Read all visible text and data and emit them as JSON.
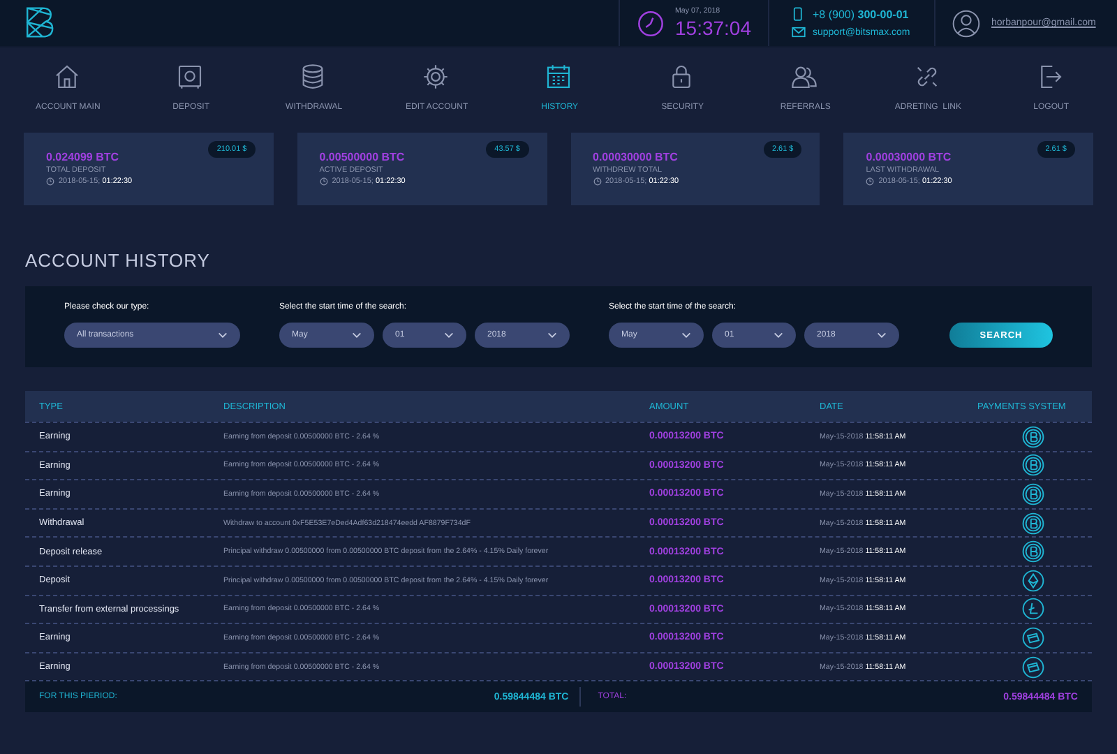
{
  "header": {
    "date": "May 07, 2018",
    "time": "15:37:04",
    "phone_prefix": "+8 (900) ",
    "phone_number": "300-00-01",
    "email": "support@bitsmax.com",
    "user_email": "horbanpour@gmail.com"
  },
  "nav": [
    {
      "label": "ACCOUNT MAIN",
      "kind": "home",
      "selected": false
    },
    {
      "label": "DEPOSIT",
      "kind": "safe",
      "selected": false
    },
    {
      "label": "WITHDRAWAL",
      "kind": "coins",
      "selected": false
    },
    {
      "label": "EDIT ACCOUNT",
      "kind": "gear",
      "selected": false
    },
    {
      "label": "HISTORY",
      "kind": "calendar",
      "selected": true
    },
    {
      "label": "SECURITY",
      "kind": "lock",
      "selected": false
    },
    {
      "label": "REFERRALS",
      "kind": "users",
      "selected": false
    },
    {
      "label": "ADRETING  LINK",
      "kind": "link",
      "selected": false
    },
    {
      "label": "LOGOUT",
      "kind": "logout",
      "selected": false
    }
  ],
  "cards": [
    {
      "amount": "0.024099 BTC",
      "usd": "210.01 $",
      "label": "TOTAL DEPOSIT",
      "date": "2018-05-15;",
      "time": "01:22:30"
    },
    {
      "amount": "0.00500000 BTC",
      "usd": "43.57 $",
      "label": "ACTIVE DEPOSIT",
      "date": "2018-05-15;",
      "time": "01:22:30"
    },
    {
      "amount": "0.00030000 BTC",
      "usd": "2.61 $",
      "label": "WITHDREW TOTAL",
      "date": "2018-05-15;",
      "time": "01:22:30"
    },
    {
      "amount": "0.00030000 BTC",
      "usd": "2.61 $",
      "label": "LAST WITHDRAWAL",
      "date": "2018-05-15;",
      "time": "01:22:30"
    }
  ],
  "title": "ACCOUNT HISTORY",
  "filters": [
    {
      "label": "Please check our type:",
      "selects": [
        "All transactions"
      ]
    },
    {
      "label": "Select the start time of the search:",
      "selects": [
        "May",
        "01",
        "2018"
      ]
    },
    {
      "label": "Select the start time of the search:",
      "selects": [
        "May",
        "01",
        "2018"
      ]
    }
  ],
  "search_button": "SEARCH",
  "table": {
    "columns": [
      "TYPE",
      "DESCRIPTION",
      "AMOUNT",
      "DATE",
      "PAYMENTS SYSTEM"
    ],
    "rows": [
      {
        "type": "Earning",
        "description": "Earning from deposit 0.00500000 BTC - 2.64 %",
        "amount": "0.00013200 BTC",
        "date": "May-15-2018",
        "time": "11:58:11 AM",
        "kind": "btc"
      },
      {
        "type": "Earning",
        "description": "Earning from deposit 0.00500000 BTC - 2.64 %",
        "amount": "0.00013200 BTC",
        "date": "May-15-2018",
        "time": "11:58:11 AM",
        "kind": "btc"
      },
      {
        "type": "Earning",
        "description": "Earning from deposit 0.00500000 BTC - 2.64 %",
        "amount": "0.00013200 BTC",
        "date": "May-15-2018",
        "time": "11:58:11 AM",
        "kind": "btc"
      },
      {
        "type": "Withdrawal",
        "description": "Withdraw to account 0xF5E53E7eDed4Adf63d218474eedd AF8879F734dF",
        "amount": "0.00013200 BTC",
        "date": "May-15-2018",
        "time": "11:58:11 AM",
        "kind": "btc"
      },
      {
        "type": "Deposit release",
        "description": "Principal withdraw 0.00500000 from 0.00500000 BTC deposit from the 2.64% - 4.15% Daily forever",
        "amount": "0.00013200 BTC",
        "date": "May-15-2018",
        "time": "11:58:11 AM",
        "kind": "btc"
      },
      {
        "type": "Deposit",
        "description": "Principal withdraw 0.00500000 from 0.00500000 BTC deposit from the 2.64% - 4.15% Daily forever",
        "amount": "0.00013200 BTC",
        "date": "May-15-2018",
        "time": "11:58:11 AM",
        "kind": "eth"
      },
      {
        "type": "Transfer from external processings",
        "description": "Earning from deposit 0.00500000 BTC - 2.64 %",
        "amount": "0.00013200 BTC",
        "date": "May-15-2018",
        "time": "11:58:11 AM",
        "kind": "ltc"
      },
      {
        "type": "Earning",
        "description": "Earning from deposit 0.00500000 BTC - 2.64 %",
        "amount": "0.00013200 BTC",
        "date": "May-15-2018",
        "time": "11:58:11 AM",
        "kind": "card"
      },
      {
        "type": "Earning",
        "description": "Earning from deposit 0.00500000 BTC - 2.64 %",
        "amount": "0.00013200 BTC",
        "date": "May-15-2018",
        "time": "11:58:11 AM",
        "kind": "card"
      }
    ],
    "footer": {
      "period_label": "FOR THIS PIERIOD:",
      "period_value": "0.59844484 BTC",
      "total_label": "TOTAL:",
      "total_value": "0.59844484 BTC"
    }
  }
}
